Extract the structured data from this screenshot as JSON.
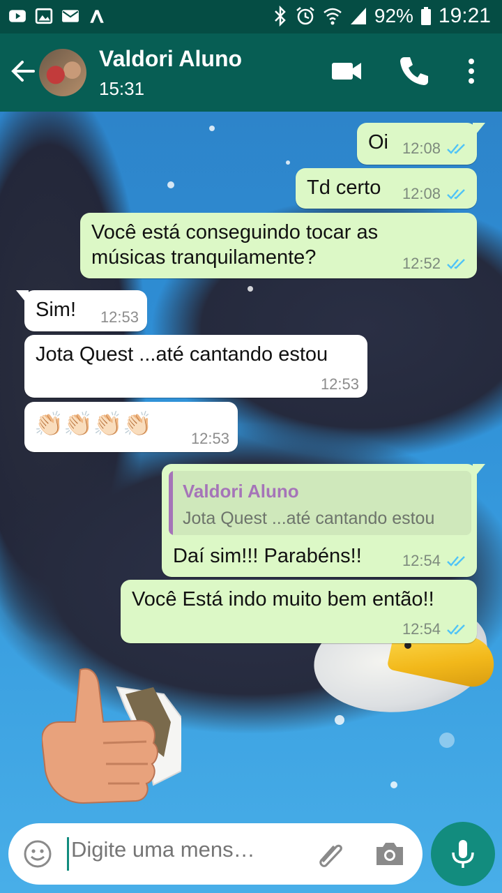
{
  "statusbar": {
    "battery": "92%",
    "time": "19:21",
    "left_icons": [
      "youtube-icon",
      "gallery-icon",
      "mail-icon",
      "app-icon"
    ],
    "right_icons": [
      "bluetooth-icon",
      "alarm-icon",
      "wifi-icon",
      "signal-icon",
      "battery-icon"
    ]
  },
  "header": {
    "contact_name": "Valdori Aluno",
    "last_seen": "15:31",
    "icons": [
      "back-arrow-icon",
      "avatar",
      "video-call-icon",
      "phone-icon",
      "more-vertical-icon"
    ]
  },
  "messages": [
    {
      "direction": "outgoing",
      "text": "Oi",
      "time": "12:08",
      "status": "read"
    },
    {
      "direction": "outgoing",
      "text": "Td certo",
      "time": "12:08",
      "status": "read"
    },
    {
      "direction": "outgoing",
      "text": [
        "Você está conseguindo tocar as",
        "músicas tranquilamente?"
      ],
      "time": "12:52",
      "status": "read"
    },
    {
      "direction": "incoming",
      "text": "Sim!",
      "time": "12:53"
    },
    {
      "direction": "incoming",
      "text": "Jota Quest ...até cantando estou",
      "time": "12:53"
    },
    {
      "direction": "incoming",
      "text": "👏🏻👏🏻👏🏻👏🏻",
      "time": "12:53"
    },
    {
      "direction": "outgoing",
      "quote": {
        "author": "Valdori Aluno",
        "text": "Jota Quest ...até cantando estou"
      },
      "text": "Daí sim!!! Parabéns!!",
      "time": "12:54",
      "status": "read"
    },
    {
      "direction": "outgoing",
      "text": "Você Está indo muito bem então!!",
      "time": "12:54",
      "status": "read"
    }
  ],
  "composer": {
    "placeholder": "Digite uma mens…",
    "icons": [
      "emoji-icon",
      "attach-icon",
      "camera-icon",
      "mic-icon"
    ]
  },
  "colors": {
    "header": "#075e54",
    "statusbar": "#054d44",
    "outgoing_bubble": "#dcf8c6",
    "incoming_bubble": "#ffffff",
    "read_ticks": "#4fc3f7",
    "mic_button": "#128c7e",
    "quote_author": "#a574b8"
  }
}
